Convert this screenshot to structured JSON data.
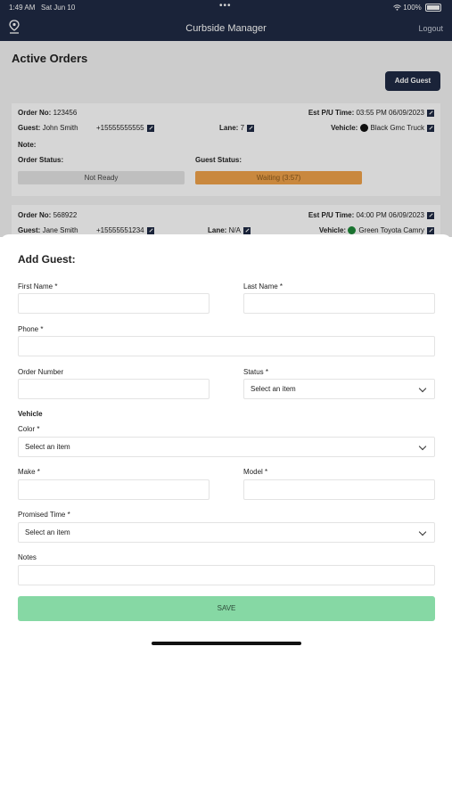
{
  "status_bar": {
    "time": "1:49 AM",
    "date": "Sat Jun 10",
    "battery": "100%"
  },
  "nav": {
    "title": "Curbside Manager",
    "logout": "Logout",
    "location_icon": "map-pin-icon"
  },
  "active_orders": {
    "title": "Active Orders",
    "add_guest_label": "Add Guest",
    "orders": [
      {
        "order_no_label": "Order No:",
        "order_no": "123456",
        "pu_label": "Est P/U Time:",
        "pu_time": "03:55 PM 06/09/2023",
        "guest_label": "Guest:",
        "guest": "John Smith",
        "phone": "+15555555555",
        "lane_label": "Lane:",
        "lane": "7",
        "vehicle_label": "Vehicle:",
        "vehicle": "Black Gmc Truck",
        "vehicle_color": "#111111",
        "note_label": "Note:",
        "order_status_label": "Order Status:",
        "order_status": "Not Ready",
        "guest_status_label": "Guest Status:",
        "guest_status": "Waiting (3:57)"
      },
      {
        "order_no_label": "Order No:",
        "order_no": "568922",
        "pu_label": "Est P/U Time:",
        "pu_time": "04:00 PM 06/09/2023",
        "guest_label": "Guest:",
        "guest": "Jane Smith",
        "phone": "+15555551234",
        "lane_label": "Lane:",
        "lane": "N/A",
        "vehicle_label": "Vehicle:",
        "vehicle": "Green Toyota Camry",
        "vehicle_color": "#1f8a3a"
      }
    ]
  },
  "form": {
    "title": "Add Guest:",
    "first_name_label": "First Name *",
    "last_name_label": "Last Name *",
    "phone_label": "Phone *",
    "order_number_label": "Order Number",
    "status_label": "Status *",
    "status_value": "Select an item",
    "vehicle_heading": "Vehicle",
    "color_label": "Color *",
    "color_value": "Select an item",
    "make_label": "Make *",
    "model_label": "Model *",
    "promised_time_label": "Promised Time *",
    "promised_time_value": "Select an item",
    "notes_label": "Notes",
    "save_label": "SAVE"
  },
  "colors": {
    "navy": "#1f2a44",
    "save_green": "#86d8a4",
    "waiting_orange": "#f0a24a"
  }
}
